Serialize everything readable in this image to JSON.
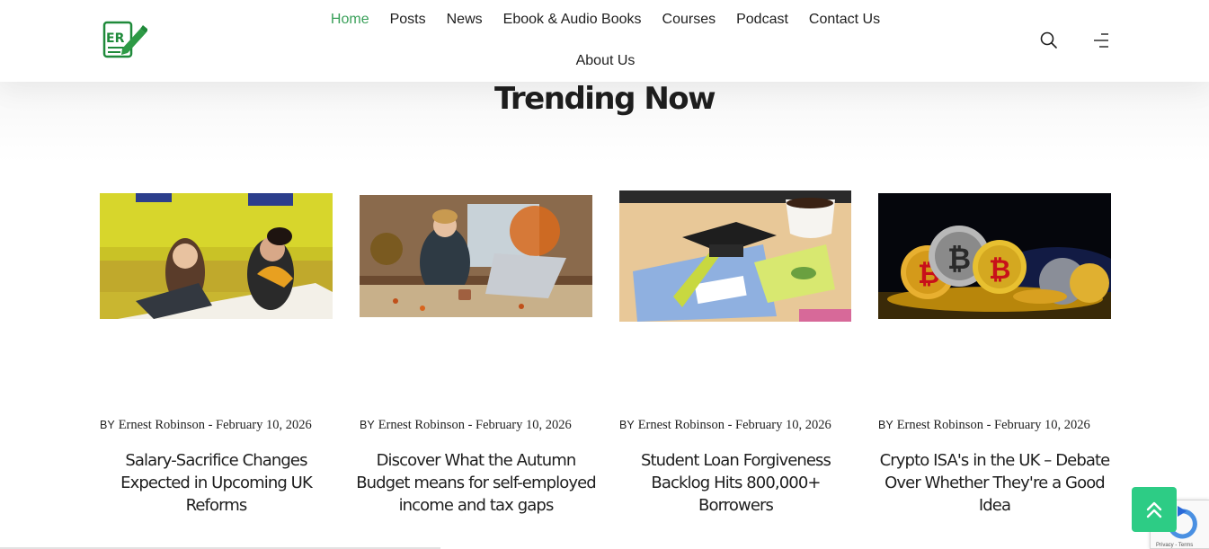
{
  "header": {
    "logo_text": "ER",
    "nav": [
      {
        "label": "Home",
        "active": true
      },
      {
        "label": "Posts"
      },
      {
        "label": "News"
      },
      {
        "label": "Ebook & Audio Books"
      },
      {
        "label": "Courses"
      },
      {
        "label": "Podcast"
      },
      {
        "label": "Contact Us"
      },
      {
        "label": "About Us"
      }
    ],
    "icons": [
      "search-icon",
      "menu-icon"
    ]
  },
  "section": {
    "title": "Trending Now"
  },
  "posts": [
    {
      "image": "photo: two women working at a laptop in a yellow-walled office",
      "by": "BY",
      "author": "Ernest Robinson",
      "date": "February 10, 2026",
      "title": "Salary-Sacrifice Changes Expected in Upcoming UK Reforms"
    },
    {
      "image": "photo: smiling woman at laptop in office with autumn leaves",
      "by": "BY",
      "author": "Ernest Robinson",
      "date": "February 10, 2026",
      "title": "Discover What the Autumn Budget means for self-employed income and tax gaps"
    },
    {
      "image": "photo: graduation cap, blue card and coffee cup on desk",
      "by": "BY",
      "author": "Ernest Robinson",
      "date": "February 10, 2026",
      "title": "Student Loan Forgiveness Backlog Hits 800,000+ Borrowers"
    },
    {
      "image": "photo: gold bitcoin coins stacked on dark background",
      "by": "BY",
      "author": "Ernest Robinson",
      "date": "February 10, 2026",
      "title": "Crypto ISA's in the UK – Debate Over Whether They're a Good Idea"
    }
  ],
  "recaptcha": {
    "text": "Privacy - Terms"
  },
  "colors": {
    "accent": "#3aa05a",
    "scroll_top": "#2dcc85",
    "logo": "#1f8a3a"
  }
}
